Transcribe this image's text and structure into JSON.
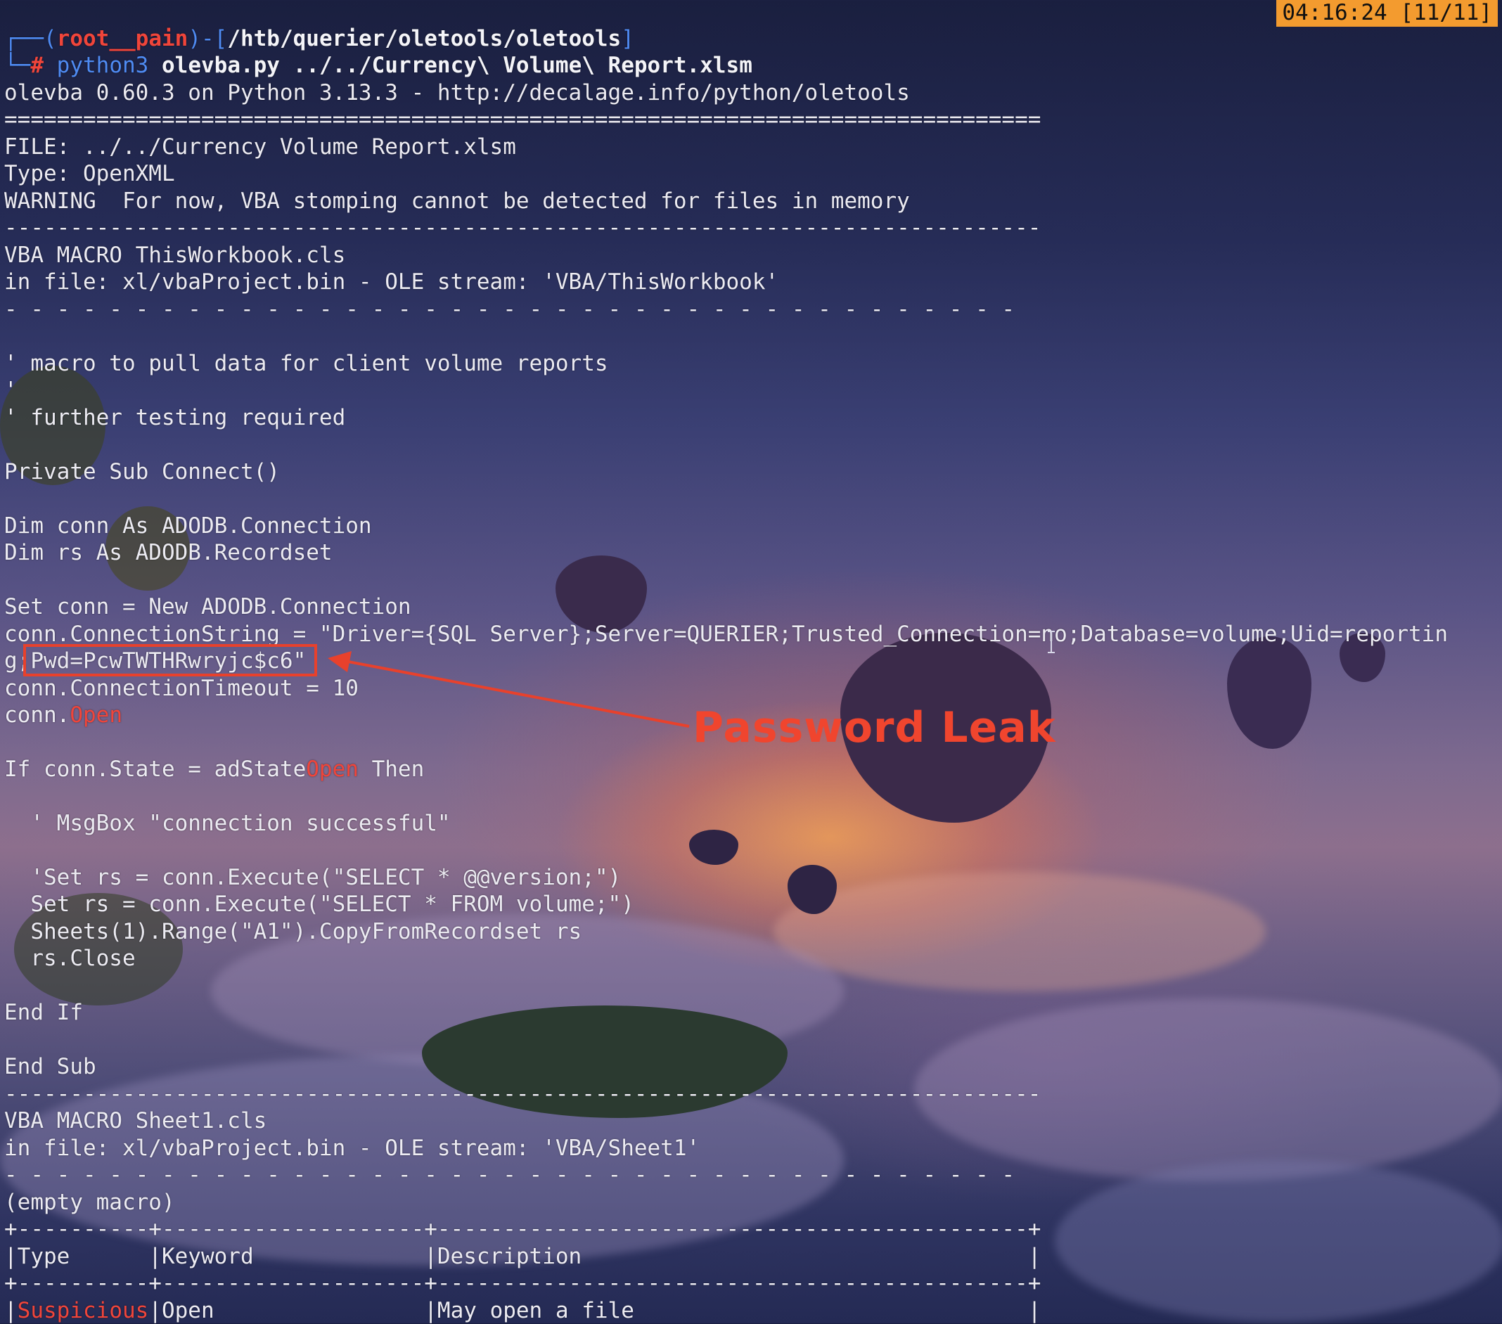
{
  "clock": "04:16:24 [11/11]",
  "prompt": {
    "corner": "┌──",
    "open_paren": "(",
    "user": "root__pain",
    "close_paren": ")-[",
    "path": "/htb/querier/oletools/oletools",
    "close_bracket": "]",
    "hash_corner": "└─",
    "hash": "#",
    "cmd": "python3",
    "args": "olevba.py ../../Currency\\ Volume\\ Report.xlsm"
  },
  "lines": {
    "banner": "olevba 0.60.3 on Python 3.13.3 - http://decalage.info/python/oletools",
    "sep_eq": "===============================================================================",
    "file": "FILE: ../../Currency Volume Report.xlsm",
    "type": "Type: OpenXML",
    "warning": "WARNING  For now, VBA stomping cannot be detected for files in memory",
    "sep_dash": "-------------------------------------------------------------------------------",
    "macro1_name": "VBA MACRO ThisWorkbook.cls",
    "macro1_in": "in file: xl/vbaProject.bin - OLE stream: 'VBA/ThisWorkbook'",
    "sep_spaced": "- - - - - - - - - - - - - - - - - - - - - - - - - - - - - - - - - - - - - - - ",
    "c1": "' macro to pull data for client volume reports",
    "c2": "'",
    "c3": "' further testing required",
    "sub": "Private Sub Connect()",
    "dim1": "Dim conn As ADODB.Connection",
    "dim2": "Dim rs As ADODB.Recordset",
    "set_conn": "Set conn = New ADODB.Connection",
    "connstr": "conn.ConnectionString = \"Driver={SQL Server};Server=QUERIER;Trusted_Connection=no;Database=volume;Uid=reportin",
    "connstr_wrap_prefix": "g;",
    "connstr_wrap_pwd": "Pwd=PcwTWTHRwryjc$c6\"",
    "timeout": "conn.ConnectionTimeout = 10",
    "open_prefix": "conn.",
    "open_kw": "Open",
    "if_prefix": "If conn.State = adState",
    "if_kw": "Open",
    "if_suffix": " Then",
    "msgbox": "  ' MsgBox \"connection successful\"",
    "set_rs_comment": "  'Set rs = conn.Execute(\"SELECT * @@version;\")",
    "set_rs": "  Set rs = conn.Execute(\"SELECT * FROM volume;\")",
    "sheets": "  Sheets(1).Range(\"A1\").CopyFromRecordset rs",
    "rs_close": "  rs.Close",
    "end_if": "End If",
    "end_sub": "End Sub",
    "macro2_name": "VBA MACRO Sheet1.cls",
    "macro2_in": "in file: xl/vbaProject.bin - OLE stream: 'VBA/Sheet1'",
    "empty_macro": "(empty macro)",
    "table_border": "+----------+--------------------+---------------------------------------------+",
    "table_header": "|Type      |Keyword             |Description                                  |",
    "row_pipe": "|",
    "row_type": "Suspicious",
    "row_rest": "|Open                |May open a file                              |"
  },
  "annotation": {
    "label": "Password Leak",
    "color": "#f0452e"
  },
  "colors": {
    "prompt_blue": "#4f8bf3",
    "prompt_red": "#f0453a",
    "clock_bg": "#f39b2f"
  }
}
